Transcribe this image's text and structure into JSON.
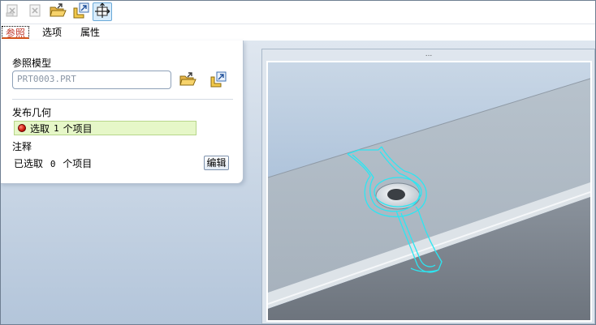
{
  "toolbar": {
    "buttons": [
      {
        "name": "dimmed-x-icon",
        "active": false
      },
      {
        "name": "dimmed-x-icon",
        "active": false
      },
      {
        "name": "open-folder-icon",
        "active": false
      },
      {
        "name": "copy-geometry-icon",
        "active": false
      },
      {
        "name": "move-tool-icon",
        "active": true
      }
    ]
  },
  "tabs": [
    "参照",
    "选项",
    "属性"
  ],
  "panel": {
    "ref_model_label": "参照模型",
    "ref_model_value": "PRT0003.PRT",
    "publish_geometry_label": "发布几何",
    "selector_text": "选取",
    "selector_count": "1",
    "selector_unit": "个项目",
    "notes_label": "注释",
    "notes_selected": "已选取",
    "notes_count": "0",
    "notes_unit": "个项目",
    "edit_button": "编辑"
  },
  "viewport": {
    "grip": "...",
    "colors": {
      "background_top": "#c8d6e6",
      "background_bottom": "#5a7ab0",
      "beam_top": "#aeb9c4",
      "beam_front": "#7f8792",
      "highlight": "#2fe2f0"
    }
  }
}
